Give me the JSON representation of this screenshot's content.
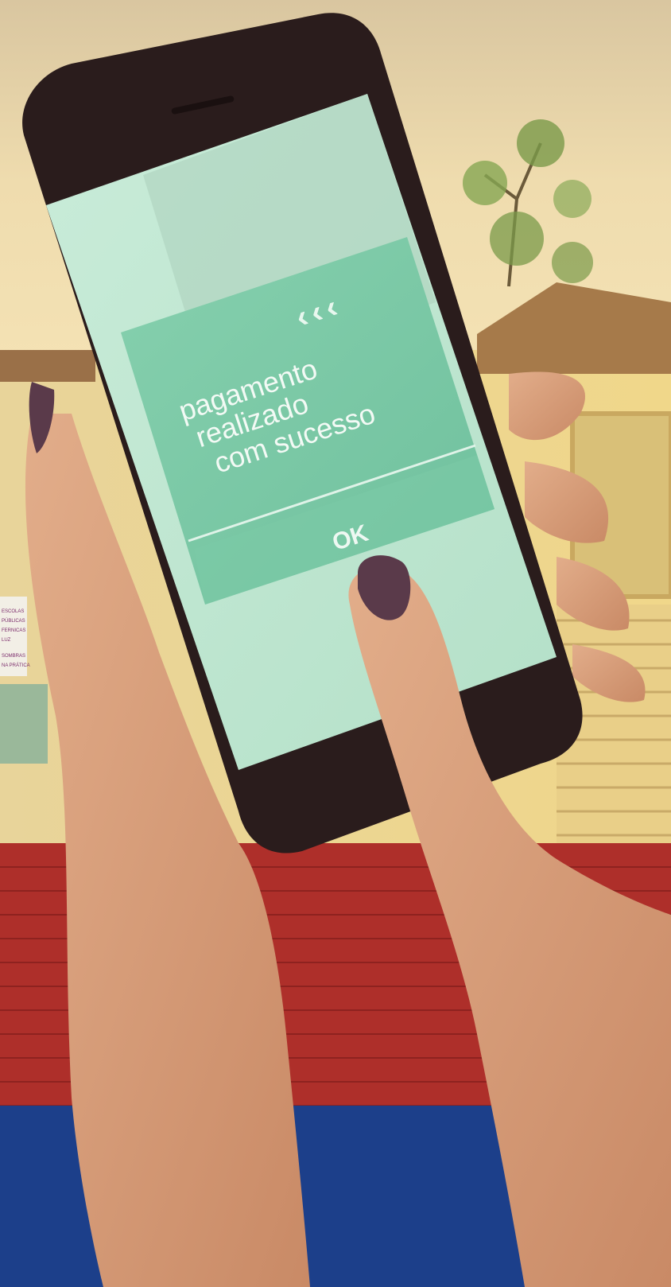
{
  "screen": {
    "message_lines": [
      "pagamento",
      "realizado",
      "com sucesso"
    ],
    "ok_label": "OK"
  },
  "poster": {
    "lines": [
      "ESCOLAS",
      "PÚBLICAS",
      "FERNICAS",
      "LUZ",
      "SOMBRAS",
      "NA PRÁTICA"
    ]
  },
  "colors": {
    "sky": "#e8d5a8",
    "screen_bg": "#bfe6d2",
    "dialog": "#7fcaa9",
    "brick_red": "#b0302c",
    "floor_blue": "#1c3f8a",
    "phone_body": "#2a1c1c",
    "skin": "#d9a27f",
    "nail": "#5a3a4a"
  },
  "icons": [
    "arrows-icon",
    "nail-polish"
  ]
}
